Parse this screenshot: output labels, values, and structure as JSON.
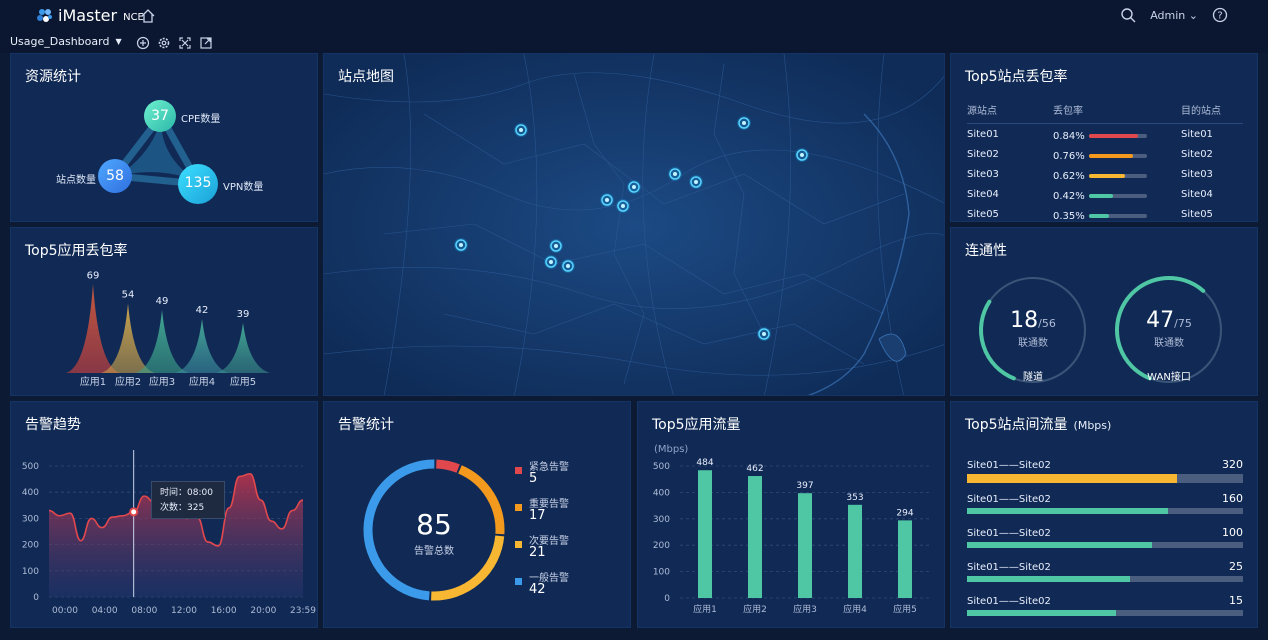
{
  "app": {
    "name": "iMaster",
    "suffix": "NCE",
    "user": "Admin",
    "dashboard": "Usage_Dashboard"
  },
  "icons": {
    "logo": "huawei-logo-icon",
    "home": "home-icon",
    "search": "search-icon",
    "help": "help-icon",
    "add": "add-icon",
    "settings": "gear-icon",
    "fullscreen": "fullscreen-icon",
    "export": "export-icon"
  },
  "colors": {
    "bg": "#0c1a33",
    "panel": "#112a55",
    "teal": "#4fc6a4",
    "red": "#e0484d",
    "orange": "#f39a1e",
    "yellow": "#f7b733",
    "blue": "#3b9bea"
  },
  "resource": {
    "title": "资源统计",
    "cpe": {
      "value": "37",
      "label": "CPE数量"
    },
    "site": {
      "value": "58",
      "label": "站点数量"
    },
    "vpn": {
      "value": "135",
      "label": "VPN数量"
    }
  },
  "app_loss": {
    "title": "Top5应用丢包率",
    "values": [
      "69",
      "54",
      "49",
      "42",
      "39"
    ],
    "apps": [
      "应用1",
      "应用2",
      "应用3",
      "应用4",
      "应用5"
    ]
  },
  "map": {
    "title": "站点地图"
  },
  "site_loss": {
    "title": "Top5站点丢包率",
    "headers": [
      "源站点",
      "丢包率",
      "目的站点"
    ],
    "rows": [
      {
        "src": "Site01",
        "rate": "0.84%",
        "dst": "Site01",
        "pct": 0.84,
        "color": "#e0484d"
      },
      {
        "src": "Site02",
        "rate": "0.76%",
        "dst": "Site02",
        "pct": 0.76,
        "color": "#f39a1e"
      },
      {
        "src": "Site03",
        "rate": "0.62%",
        "dst": "Site03",
        "pct": 0.62,
        "color": "#f7b733"
      },
      {
        "src": "Site04",
        "rate": "0.42%",
        "dst": "Site04",
        "pct": 0.42,
        "color": "#4fc6a4"
      },
      {
        "src": "Site05",
        "rate": "0.35%",
        "dst": "Site05",
        "pct": 0.35,
        "color": "#4fc6a4"
      }
    ]
  },
  "connectivity": {
    "title": "连通性",
    "tunnel": {
      "value": "18",
      "total": "/56",
      "sub": "联通数",
      "label": "隧道",
      "fraction": 0.32
    },
    "wan": {
      "value": "47",
      "total": "/75",
      "sub": "联通数",
      "label": "WAN接口",
      "fraction": 0.63
    }
  },
  "alarm_trend": {
    "title": "告警趋势",
    "tooltip": {
      "time_label": "时间：08:00",
      "count_label": "次数：325"
    }
  },
  "alarm_stats": {
    "title": "告警统计",
    "total": "85",
    "total_label": "告警总数",
    "items": [
      {
        "label": "紧急告警",
        "value": "5",
        "color": "#e0484d"
      },
      {
        "label": "重要告警",
        "value": "17",
        "color": "#f39a1e"
      },
      {
        "label": "次要告警",
        "value": "21",
        "color": "#f7b733"
      },
      {
        "label": "一般告警",
        "value": "42",
        "color": "#3b9bea"
      }
    ]
  },
  "app_flow": {
    "title": "Top5应用流量",
    "unit": "(Mbps)"
  },
  "site_flow": {
    "title": "Top5站点间流量",
    "unit": "(Mbps)",
    "rows": [
      {
        "name": "Site01——Site02",
        "value": "320",
        "fraction": 0.76,
        "color": "#f7b733"
      },
      {
        "name": "Site01——Site02",
        "value": "160",
        "fraction": 0.73,
        "color": "#4fc6a4"
      },
      {
        "name": "Site01——Site02",
        "value": "100",
        "fraction": 0.67,
        "color": "#4fc6a4"
      },
      {
        "name": "Site01——Site02",
        "value": "25",
        "fraction": 0.59,
        "color": "#4fc6a4"
      },
      {
        "name": "Site01——Site02",
        "value": "15",
        "fraction": 0.54,
        "color": "#4fc6a4"
      }
    ]
  },
  "chart_data": [
    {
      "type": "area",
      "title": "Top5应用丢包率",
      "categories": [
        "应用1",
        "应用2",
        "应用3",
        "应用4",
        "应用5"
      ],
      "values": [
        69,
        54,
        49,
        42,
        39
      ],
      "colors": [
        "#e86a3a",
        "#f0a53a",
        "#4fc6a4",
        "#4fc6a4",
        "#4fc6a4"
      ]
    },
    {
      "type": "line",
      "title": "告警趋势",
      "x": [
        "00:00",
        "01:00",
        "02:00",
        "03:00",
        "04:00",
        "05:00",
        "06:00",
        "07:00",
        "08:00",
        "09:00",
        "10:00",
        "11:00",
        "12:00",
        "13:00",
        "14:00",
        "15:00",
        "16:00",
        "17:00",
        "18:00",
        "19:00",
        "20:00",
        "21:00",
        "22:00",
        "23:00",
        "23:59"
      ],
      "x_ticks": [
        "00:00",
        "04:00",
        "08:00",
        "12:00",
        "16:00",
        "20:00",
        "23:59"
      ],
      "y_ticks": [
        "0",
        "100",
        "200",
        "300",
        "400",
        "500"
      ],
      "values": [
        330,
        310,
        320,
        215,
        300,
        265,
        305,
        310,
        325,
        385,
        360,
        330,
        310,
        300,
        305,
        210,
        195,
        340,
        460,
        470,
        370,
        290,
        260,
        330,
        370
      ],
      "ylim": [
        0,
        500
      ],
      "grid": true
    },
    {
      "type": "pie",
      "title": "告警统计",
      "labels": [
        "紧急告警",
        "重要告警",
        "次要告警",
        "一般告警"
      ],
      "values": [
        5,
        17,
        21,
        42
      ]
    },
    {
      "type": "bar",
      "title": "Top5应用流量",
      "ylabel": "(Mbps)",
      "categories": [
        "应用1",
        "应用2",
        "应用3",
        "应用4",
        "应用5"
      ],
      "values": [
        484,
        462,
        397,
        353,
        294
      ],
      "y_ticks": [
        "0",
        "100",
        "200",
        "300",
        "400",
        "500"
      ],
      "ylim": [
        0,
        500
      ]
    },
    {
      "type": "bar",
      "title": "Top5站点间流量",
      "ylabel": "(Mbps)",
      "categories": [
        "Site01——Site02",
        "Site01——Site02",
        "Site01——Site02",
        "Site01——Site02",
        "Site01——Site02"
      ],
      "values": [
        320,
        160,
        100,
        25,
        15
      ]
    }
  ]
}
